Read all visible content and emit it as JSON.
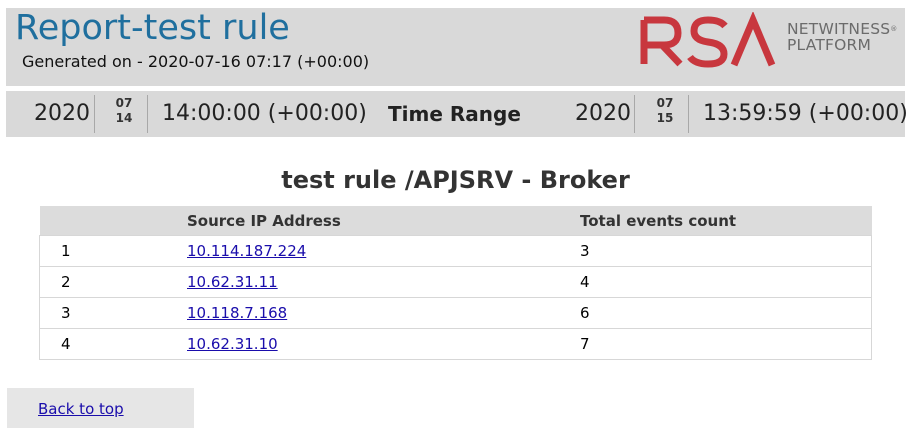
{
  "header": {
    "title": "Report-test rule",
    "generated": "Generated on - 2020-07-16 07:17 (+00:00)",
    "logo": {
      "mark": "RSA",
      "line1": "NETWITNESS",
      "line2": "PLATFORM",
      "reg": "®"
    }
  },
  "time_range": {
    "label": "Time Range",
    "start": {
      "year": "2020",
      "month": "07",
      "day": "14",
      "time": "14:00:00 (+00:00)"
    },
    "end": {
      "year": "2020",
      "month": "07",
      "day": "15",
      "time": "13:59:59 (+00:00)"
    }
  },
  "section": {
    "title": "test rule /APJSRV - Broker",
    "columns": [
      "",
      "Source IP Address",
      "Total events count"
    ],
    "rows": [
      {
        "index": "1",
        "ip": "10.114.187.224",
        "count": "3"
      },
      {
        "index": "2",
        "ip": "10.62.31.11",
        "count": "4"
      },
      {
        "index": "3",
        "ip": "10.118.7.168",
        "count": "6"
      },
      {
        "index": "4",
        "ip": "10.62.31.10",
        "count": "7"
      }
    ]
  },
  "footer": {
    "back_to_top": "Back to top"
  },
  "colors": {
    "title": "#1f6f9e",
    "logo_red": "#c8373e",
    "link": "#1a0dab",
    "panel": "#d9d9d9"
  }
}
